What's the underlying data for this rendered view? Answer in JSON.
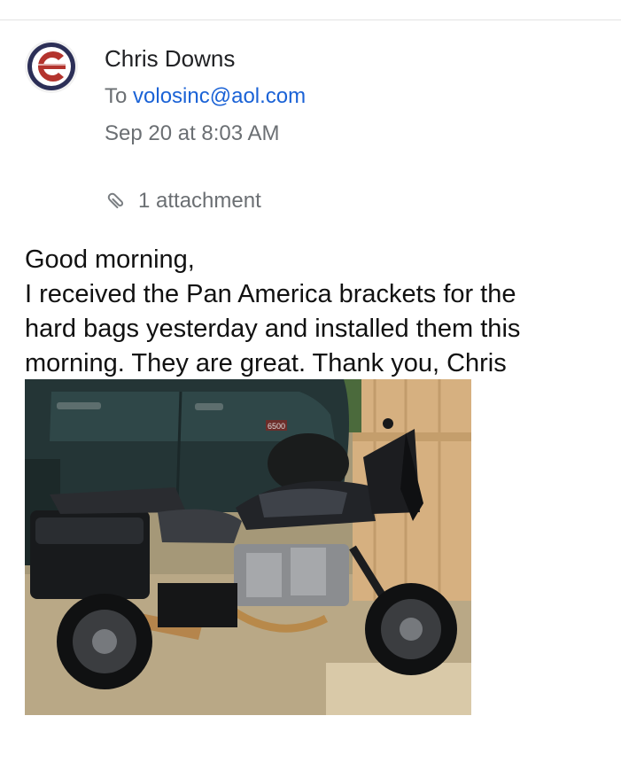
{
  "email": {
    "sender_name": "Chris Downs",
    "to_label": "To",
    "to_address": "volosinc@aol.com",
    "date": "Sep 20 at 8:03 AM",
    "attachment_count_label": "1 attachment"
  },
  "body": {
    "lines": [
      "Good morning,",
      "I received the Pan America brackets for the",
      "hard bags yesterday and installed them this",
      "morning. They are great. Thank you, Chris"
    ]
  },
  "photo": {
    "truck_badge": "6500"
  },
  "icons": {
    "avatar": "c-logo-avatar",
    "attachment": "paperclip-icon"
  },
  "colors": {
    "link": "#1a62d6",
    "secondary_text": "#6b6f73",
    "primary_text": "#202124"
  }
}
